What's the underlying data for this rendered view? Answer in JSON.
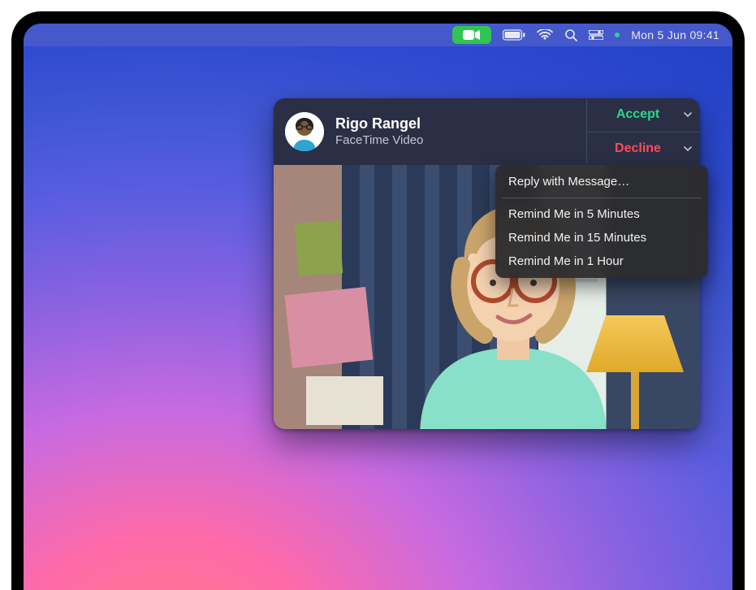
{
  "menubar": {
    "date_time": "Mon 5 Jun  09:41"
  },
  "notification": {
    "caller_name": "Rigo Rangel",
    "call_type": "FaceTime Video",
    "accept_label": "Accept",
    "decline_label": "Decline"
  },
  "decline_menu": {
    "reply": "Reply with Message…",
    "remind5": "Remind Me in 5 Minutes",
    "remind15": "Remind Me in 15 Minutes",
    "remind1h": "Remind Me in 1 Hour"
  }
}
